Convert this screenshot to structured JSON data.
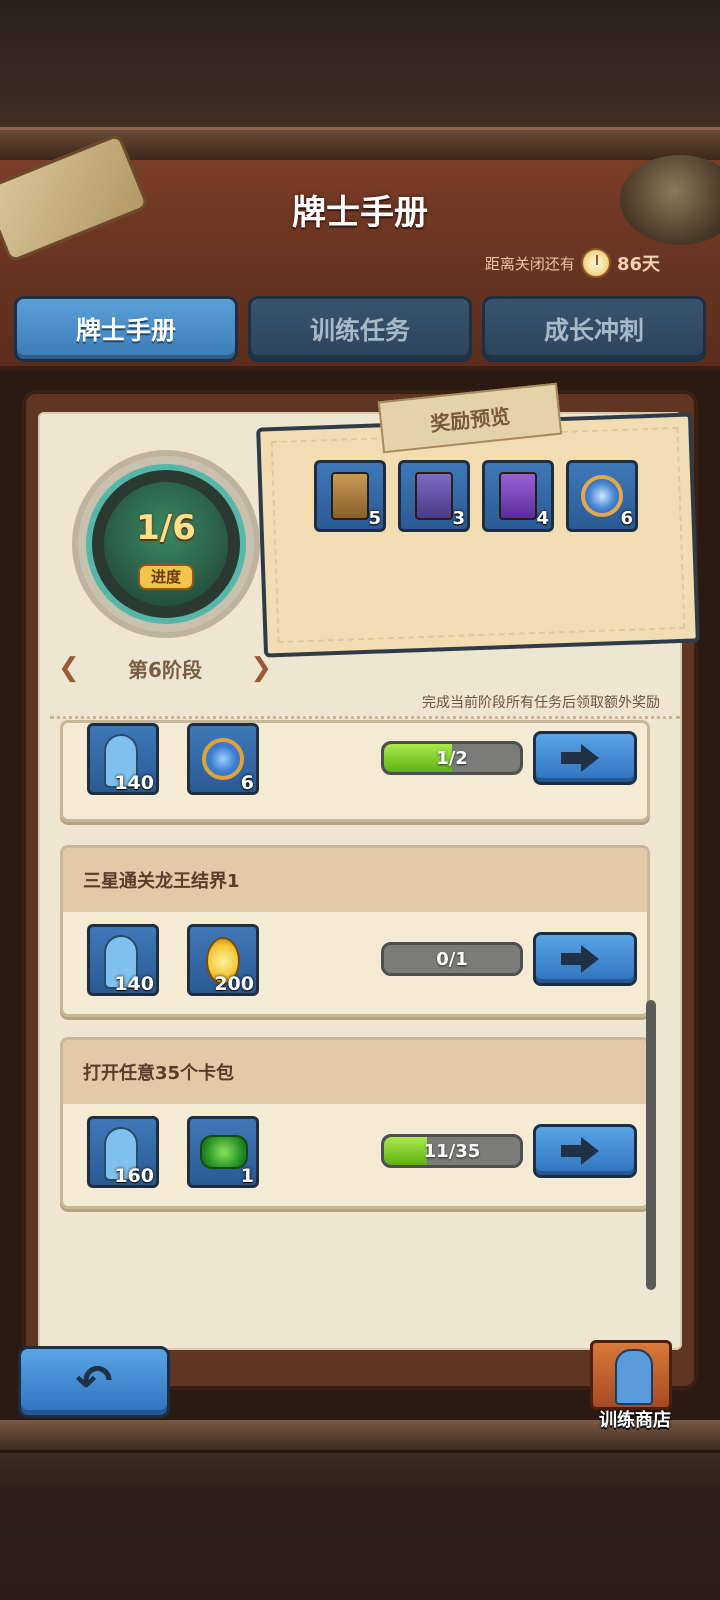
{
  "header": {
    "title": "牌士手册",
    "countdown_label": "距离关闭还有",
    "countdown_value": "86天"
  },
  "tabs": [
    {
      "label": "牌士手册",
      "active": true
    },
    {
      "label": "训练任务",
      "active": false
    },
    {
      "label": "成长冲刺",
      "active": false
    }
  ],
  "progress_badge": {
    "value": "1/6",
    "label": "进度"
  },
  "stage": {
    "label": "第6阶段"
  },
  "reward_preview": {
    "title": "奖励预览",
    "items": [
      {
        "icon": "brown-card-pack-icon",
        "count": "5"
      },
      {
        "icon": "purple-card-pack-icon",
        "count": "3"
      },
      {
        "icon": "violet-card-pack-icon",
        "count": "4"
      },
      {
        "icon": "crystal-orb-icon",
        "count": "6"
      }
    ]
  },
  "hint": "完成当前阶段所有任务后领取额外奖励",
  "tasks": [
    {
      "title": "",
      "rewards": [
        {
          "icon": "trainer-card-icon",
          "count": "140"
        },
        {
          "icon": "blue-crystal-coin-icon",
          "count": "6"
        }
      ],
      "progress_text": "1/2",
      "progress": 0.5
    },
    {
      "title": "三星通关龙王结界1",
      "rewards": [
        {
          "icon": "trainer-card-icon",
          "count": "140"
        },
        {
          "icon": "gold-coin-icon",
          "count": "200"
        }
      ],
      "progress_text": "0/1",
      "progress": 0
    },
    {
      "title": "打开任意35个卡包",
      "rewards": [
        {
          "icon": "trainer-card-icon",
          "count": "160"
        },
        {
          "icon": "green-gem-icon",
          "count": "1"
        }
      ],
      "progress_text": "11/35",
      "progress": 0.314
    }
  ],
  "shop": {
    "label": "训练商店"
  },
  "colors": {
    "tab_active": "#4a8fcb",
    "tab_inactive": "#34495f",
    "progress_fill": "#7fd12a",
    "paper": "#efe6d2"
  }
}
